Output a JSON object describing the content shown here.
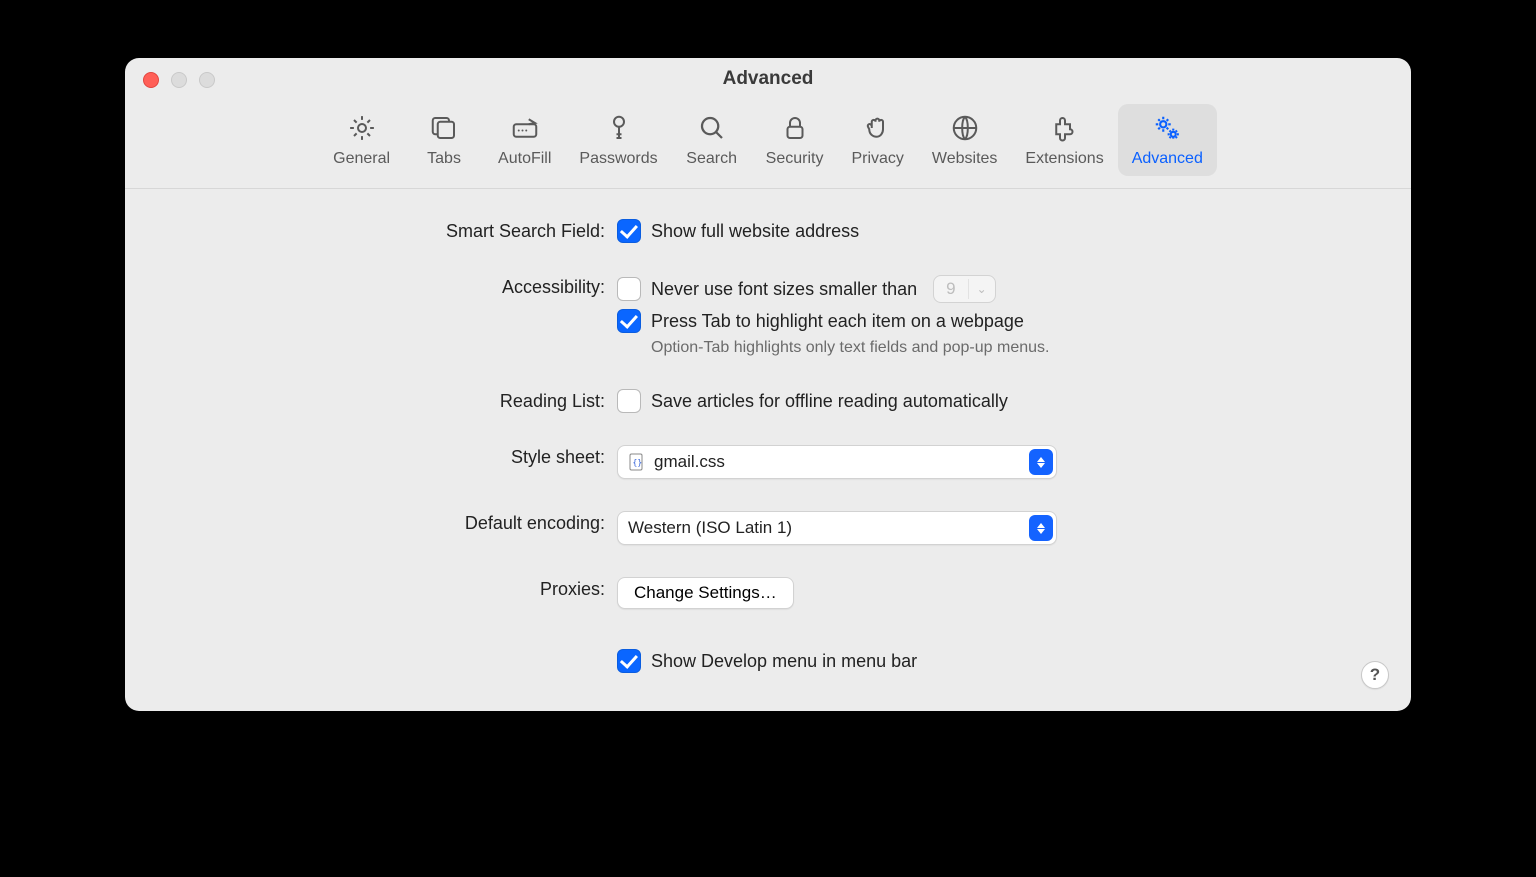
{
  "window": {
    "title": "Advanced"
  },
  "toolbar": {
    "items": [
      {
        "id": "general",
        "label": "General"
      },
      {
        "id": "tabs",
        "label": "Tabs"
      },
      {
        "id": "autofill",
        "label": "AutoFill"
      },
      {
        "id": "passwords",
        "label": "Passwords"
      },
      {
        "id": "search",
        "label": "Search"
      },
      {
        "id": "security",
        "label": "Security"
      },
      {
        "id": "privacy",
        "label": "Privacy"
      },
      {
        "id": "websites",
        "label": "Websites"
      },
      {
        "id": "extensions",
        "label": "Extensions"
      },
      {
        "id": "advanced",
        "label": "Advanced"
      }
    ],
    "selected": "advanced"
  },
  "form": {
    "smart_search": {
      "label": "Smart Search Field:",
      "show_full_address": {
        "checked": true,
        "text": "Show full website address"
      }
    },
    "accessibility": {
      "label": "Accessibility:",
      "min_font": {
        "checked": false,
        "text": "Never use font sizes smaller than",
        "value": "9"
      },
      "tab_highlight": {
        "checked": true,
        "text": "Press Tab to highlight each item on a webpage"
      },
      "hint": "Option-Tab highlights only text fields and pop-up menus."
    },
    "reading_list": {
      "label": "Reading List:",
      "offline": {
        "checked": false,
        "text": "Save articles for offline reading automatically"
      }
    },
    "stylesheet": {
      "label": "Style sheet:",
      "value": "gmail.css"
    },
    "encoding": {
      "label": "Default encoding:",
      "value": "Western (ISO Latin 1)"
    },
    "proxies": {
      "label": "Proxies:",
      "button": "Change Settings…"
    },
    "develop": {
      "checked": true,
      "text": "Show Develop menu in menu bar"
    }
  },
  "help": "?"
}
